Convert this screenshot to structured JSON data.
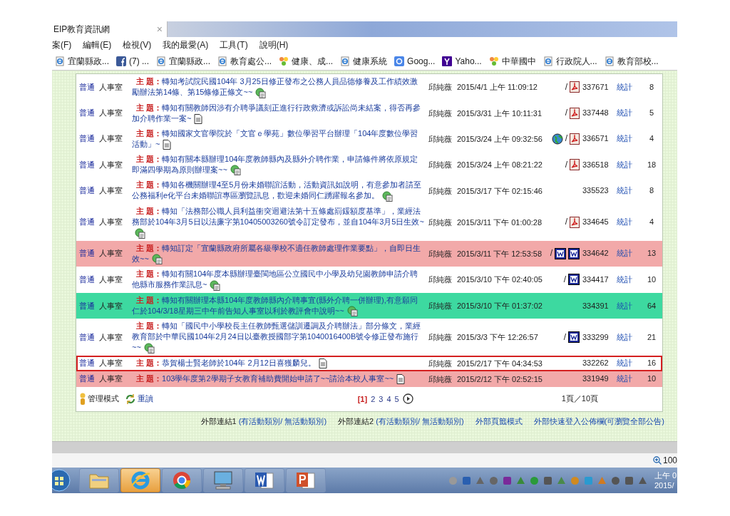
{
  "browser": {
    "tab": {
      "title": "EIP教育資訊網",
      "close": "×"
    },
    "menu": [
      "案(F)",
      "編輯(E)",
      "檢視(V)",
      "我的最愛(A)",
      "工具(T)",
      "說明(H)"
    ],
    "favorites": [
      {
        "label": "宜蘭縣政...",
        "kind": "page"
      },
      {
        "label": "(7) ...",
        "kind": "f"
      },
      {
        "label": "宜蘭縣政...",
        "kind": "page"
      },
      {
        "label": "教育處公...",
        "kind": "page"
      },
      {
        "label": "健康、成...",
        "kind": "flower"
      },
      {
        "label": "健康系統",
        "kind": "page"
      },
      {
        "label": "Goog...",
        "kind": "g"
      },
      {
        "label": "Yaho...",
        "kind": "y"
      },
      {
        "label": "中華國中",
        "kind": "flower"
      },
      {
        "label": "行政院人...",
        "kind": "page"
      },
      {
        "label": "教育部校...",
        "kind": "page"
      }
    ]
  },
  "board": {
    "rows": [
      {
        "category": "普通",
        "office": "人事室",
        "subject_label": "主 題：",
        "subject": "轉知考試院民國104年 3月25日修正發布之公務人員品德修養及工作績效激勵辦法第14條、第15條修正條文~~",
        "note": {
          "kind": "web"
        },
        "author": "邱純薇",
        "posted": "2015/4/1 上午 11:09:12",
        "slash": "/",
        "files": [
          {
            "kind": "pdf"
          }
        ],
        "id": "337671",
        "stats": "統計",
        "count": "8",
        "color": "#ffffff",
        "selected": false
      },
      {
        "category": "普通",
        "office": "人事室",
        "subject_label": "主 題：",
        "subject": "轉知有關教師因涉有介聘爭議刻正進行行政救濟或訴訟尚未結案，得否再參加介聘作業一案~",
        "note": {
          "kind": "doc"
        },
        "author": "邱純薇",
        "posted": "2015/3/31 上午 10:11:31",
        "slash": "/",
        "files": [
          {
            "kind": "pdf"
          }
        ],
        "id": "337448",
        "stats": "統計",
        "count": "5",
        "color": "#ffffff",
        "selected": false
      },
      {
        "category": "普通",
        "office": "人事室",
        "subject_label": "主 題：",
        "subject": "轉知國家文官學院於「文官ｅ學苑」數位學習平台辦理「104年度數位學習活動」~",
        "note": {
          "kind": "doc"
        },
        "author": "邱純薇",
        "posted": "2015/3/24 上午 09:32:56",
        "links": [
          {
            "kind": "globe"
          }
        ],
        "slash": "/",
        "files": [
          {
            "kind": "pdf"
          }
        ],
        "id": "336571",
        "stats": "統計",
        "count": "4",
        "color": "#ffffff",
        "selected": false
      },
      {
        "category": "普通",
        "office": "人事室",
        "subject_label": "主 題：",
        "subject": "轉知有關本縣辦理104年度教師縣內及縣外介聘作業，申請條件將依原規定即滿四學期為原則辦理案~~",
        "note": {
          "kind": "web"
        },
        "author": "邱純薇",
        "posted": "2015/3/24 上午 08:21:22",
        "slash": "/",
        "files": [
          {
            "kind": "pdf"
          }
        ],
        "id": "336518",
        "stats": "統計",
        "count": "18",
        "color": "#ffffff",
        "selected": false
      },
      {
        "category": "普通",
        "office": "人事室",
        "subject_label": "主 題：",
        "subject": "轉知各機關辦理4至5月份未婚聯誼活動，活動資訊如說明，有意參加者請至公務福利e化平台未婚聯誼專區瀏覽訊息，歡迎未婚同仁踴躍報名參加。",
        "note": {
          "kind": "web"
        },
        "author": "邱純薇",
        "posted": "2015/3/17 下午 02:15:46",
        "id": "335523",
        "stats": "統計",
        "count": "8",
        "color": "#ffffff",
        "selected": false
      },
      {
        "category": "普通",
        "office": "人事室",
        "subject_label": "主 題：",
        "subject": "轉知「法務部公職人員利益衝突迴避法第十五條處罰鍰額度基準」，業經法務部於104年3月5日以法廉字第10405003260號令訂定發布，並自104年3月5日生效~",
        "note": {
          "kind": "web"
        },
        "author": "邱純薇",
        "posted": "2015/3/11 下午 01:00:28",
        "slash": "/",
        "files": [
          {
            "kind": "pdf"
          }
        ],
        "id": "334645",
        "stats": "統計",
        "count": "4",
        "color": "#ffffff",
        "selected": false
      },
      {
        "category": "普通",
        "office": "人事室",
        "subject_label": "主 題：",
        "subject": "轉知訂定「宜蘭縣政府所屬各級學校不適任教師處理作業要點」，自即日生效~~",
        "note": {
          "kind": "web"
        },
        "author": "邱純薇",
        "posted": "2015/3/11 下午 12:53:58",
        "slash": "/",
        "files": [
          {
            "kind": "word"
          },
          {
            "kind": "word"
          }
        ],
        "id": "334642",
        "stats": "統計",
        "count": "13",
        "color": "#f2a9a9",
        "selected": false
      },
      {
        "category": "普通",
        "office": "人事室",
        "subject_label": "主 題：",
        "subject": "轉知有關104年度本縣辦理臺閩地區公立國民中小學及幼兒園教師申請介聘他縣市服務作業訊息~",
        "note": {
          "kind": "web"
        },
        "author": "邱純薇",
        "posted": "2015/3/10 下午 02:40:05",
        "slash": "/",
        "files": [
          {
            "kind": "word"
          }
        ],
        "id": "334417",
        "stats": "統計",
        "count": "10",
        "color": "#ffffff",
        "selected": false
      },
      {
        "category": "普通",
        "office": "人事室",
        "subject_label": "主 題：",
        "subject": "轉知有關辦理本縣104年度教師縣內介聘事宜(縣外介聘一併辦理),有意願同仁於104/3/18星期三中午前告知人事室以利於教評會中說明~~",
        "note": {
          "kind": "web"
        },
        "author": "邱純薇",
        "posted": "2015/3/10 下午 01:37:02",
        "id": "334391",
        "stats": "統計",
        "count": "64",
        "color": "#3dd9a0",
        "selected": false
      },
      {
        "category": "普通",
        "office": "人事室",
        "subject_label": "主 題：",
        "subject": "轉知「國民中小學校長主任教師甄選儲訓遷調及介聘辦法」部分條文，業經教育部於中華民國104年2月24日以臺教授國部字第1040016400B號令修正發布施行~~",
        "note": {
          "kind": "web"
        },
        "author": "邱純薇",
        "posted": "2015/3/3 下午 12:26:57",
        "slash": "/",
        "files": [
          {
            "kind": "word"
          }
        ],
        "id": "333299",
        "stats": "統計",
        "count": "21",
        "color": "#ffffff",
        "selected": false
      },
      {
        "category": "普通",
        "office": "人事室",
        "subject_label": "主 題：",
        "subject": "恭賀楊士賢老師於104年 2月12日喜獲麟兒。",
        "note": {
          "kind": "doc"
        },
        "author": "邱純薇",
        "posted": "2015/2/17 下午 04:34:53",
        "id": "332262",
        "stats": "統計",
        "count": "16",
        "color": "#ffffff",
        "selected": true
      },
      {
        "category": "普通",
        "office": "人事室",
        "subject_label": "主 題：",
        "subject": "103學年度第2學期子女教育補助費開始申請了~~請洽本校人事室~~",
        "note": {
          "kind": "doc"
        },
        "author": "邱純薇",
        "posted": "2015/2/12 下午 02:52:15",
        "id": "331949",
        "stats": "統計",
        "count": "10",
        "color": "#f2a9a9",
        "selected": false
      }
    ],
    "footer": {
      "admin": "管理模式",
      "reload": "重讀",
      "pages": [
        {
          "label": "[1]",
          "selected": true
        },
        {
          "label": "2",
          "selected": false
        },
        {
          "label": "3",
          "selected": false
        },
        {
          "label": "4",
          "selected": false
        },
        {
          "label": "5",
          "selected": false
        }
      ],
      "page_count": "1頁／10頁"
    }
  },
  "external_links": [
    {
      "label": "外部連結1",
      "detail": "(有活動類別/ 無活動類別)"
    },
    {
      "label": "外部連結2",
      "detail": "(有活動類別/ 無活動類別)"
    },
    {
      "detail": "外部頁籤模式"
    },
    {
      "detail": "外部快速登入公佈欄(可瀏覽全部公告)"
    }
  ],
  "status_bar": {
    "zoom": "100"
  },
  "taskbar": {
    "apps": [
      {
        "kind": "folder",
        "selected": false
      },
      {
        "kind": "browser",
        "selected": true
      },
      {
        "kind": "chrome",
        "selected": false
      },
      {
        "kind": "monitor",
        "selected": false
      },
      {
        "kind": "word",
        "selected": false
      },
      {
        "kind": "slides",
        "selected": false
      }
    ],
    "clock": [
      "上午 0",
      "2015/"
    ]
  }
}
